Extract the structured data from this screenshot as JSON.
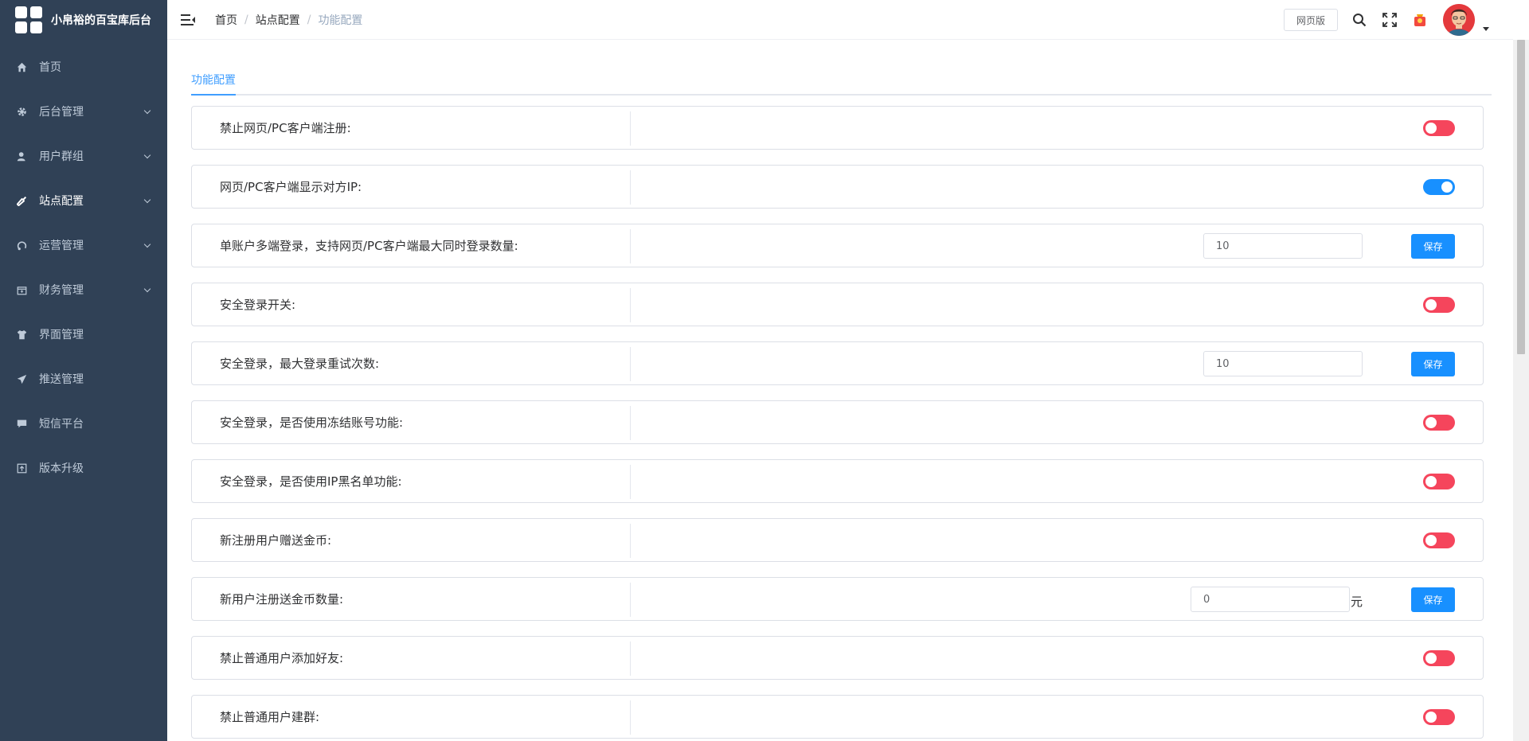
{
  "brand": {
    "title": "小帛裕的百宝库后台"
  },
  "sidebar": {
    "items": [
      {
        "label": "首页",
        "icon": "home-icon",
        "expandable": false
      },
      {
        "label": "后台管理",
        "icon": "gear-icon",
        "expandable": true
      },
      {
        "label": "用户群组",
        "icon": "user-icon",
        "expandable": true
      },
      {
        "label": "站点配置",
        "icon": "wrench-icon",
        "expandable": true,
        "active": true
      },
      {
        "label": "运营管理",
        "icon": "operation-icon",
        "expandable": true
      },
      {
        "label": "财务管理",
        "icon": "finance-icon",
        "expandable": true
      },
      {
        "label": "界面管理",
        "icon": "shirt-icon",
        "expandable": false
      },
      {
        "label": "推送管理",
        "icon": "send-icon",
        "expandable": false
      },
      {
        "label": "短信平台",
        "icon": "message-icon",
        "expandable": false
      },
      {
        "label": "版本升级",
        "icon": "upgrade-icon",
        "expandable": false
      }
    ]
  },
  "header": {
    "breadcrumb": [
      "首页",
      "站点配置",
      "功能配置"
    ],
    "web_button": "网页版"
  },
  "tab": {
    "label": "功能配置"
  },
  "settings": [
    {
      "label": "禁止网页/PC客户端注册:",
      "type": "switch",
      "on": false
    },
    {
      "label": "网页/PC客户端显示对方IP:",
      "type": "switch",
      "on": true
    },
    {
      "label": "单账户多端登录，支持网页/PC客户端最大同时登录数量:",
      "type": "input",
      "value": "10",
      "save": "保存"
    },
    {
      "label": "安全登录开关:",
      "type": "switch",
      "on": false
    },
    {
      "label": "安全登录，最大登录重试次数:",
      "type": "input",
      "value": "10",
      "save": "保存"
    },
    {
      "label": "安全登录，是否使用冻结账号功能:",
      "type": "switch",
      "on": false
    },
    {
      "label": "安全登录，是否使用IP黑名单功能:",
      "type": "switch",
      "on": false
    },
    {
      "label": "新注册用户赠送金币:",
      "type": "switch",
      "on": false
    },
    {
      "label": "新用户注册送金币数量:",
      "type": "input",
      "value": "0",
      "unit": "元",
      "save": "保存"
    },
    {
      "label": "禁止普通用户添加好友:",
      "type": "switch",
      "on": false
    },
    {
      "label": "禁止普通用户建群:",
      "type": "switch",
      "on": false
    }
  ],
  "colors": {
    "sidebar_bg": "#304156",
    "switch_off": "#f5455c",
    "switch_on": "#1890ff",
    "primary": "#1890ff",
    "tab_active": "#409eff"
  }
}
